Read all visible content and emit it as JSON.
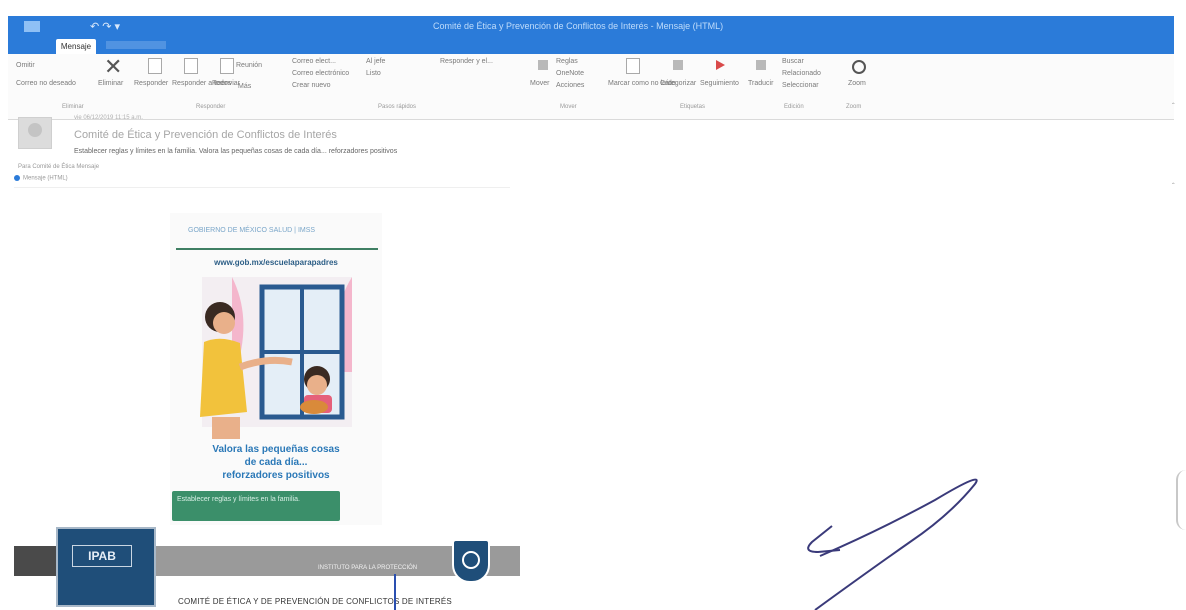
{
  "window": {
    "title": "Comité de Ética y Prevención de Conflictos de Interés - Mensaje (HTML)",
    "qat": "↶  ↷  ▾"
  },
  "tabs": {
    "active": "Mensaje"
  },
  "ribbon": {
    "ignore": "Omitir",
    "junk": "Correo no deseado",
    "delete": "Eliminar",
    "reply": "Responder",
    "reply_all": "Responder a todos",
    "forward": "Reenviar",
    "more": "Más",
    "meeting": "Reunión",
    "quick_1": "Correo elect...",
    "quick_2": "Correo electrónico",
    "quick_3": "Crear nuevo",
    "quick_4": "Al jefe",
    "quick_5": "Listo",
    "quick_6": "Responder y el...",
    "move": "Mover",
    "rules": "Reglas",
    "onenote": "OneNote",
    "actions": "Acciones",
    "mark_unread": "Marcar como no leído",
    "categorize": "Categorizar",
    "follow_up": "Seguimiento",
    "translate": "Traducir",
    "find": "Buscar",
    "related": "Relacionado",
    "select": "Seleccionar",
    "zoom": "Zoom",
    "groups": {
      "delete": "Eliminar",
      "respond": "Responder",
      "quick_steps": "Pasos rápidos",
      "move": "Mover",
      "tags": "Etiquetas",
      "editing": "Edición",
      "zoom": "Zoom"
    }
  },
  "message": {
    "date": "vie 06/12/2019 11:15 a.m.",
    "subject": "Comité de Ética y Prevención de Conflictos de Interés",
    "preview": "Establecer reglas y límites en la familia. Valora las pequeñas cosas de cada día... reforzadores positivos",
    "meta": "Para    Comité de Ética    Mensaje",
    "info": "Mensaje (HTML)"
  },
  "poster": {
    "logos": "GOBIERNO DE MÉXICO   SALUD   |  IMSS",
    "url": "www.gob.mx/escuelaparapadres",
    "headline_1": "Valora las pequeñas cosas",
    "headline_2": "de cada día...",
    "headline_3": "reforzadores positivos",
    "button": "Establecer reglas y límites en la familia."
  },
  "footer": {
    "logo_text": "IPAB",
    "bar_text": "INSTITUTO PARA LA PROTECCIÓN",
    "caption": "COMITÉ DE ÉTICA Y DE PREVENCIÓN DE CONFLICTOS DE INTERÉS"
  },
  "colors": {
    "titlebar": "#2b7bd9",
    "poster_green": "#3b8f6a",
    "poster_blue": "#2a78b7",
    "footer_navy": "#1f4e79"
  }
}
